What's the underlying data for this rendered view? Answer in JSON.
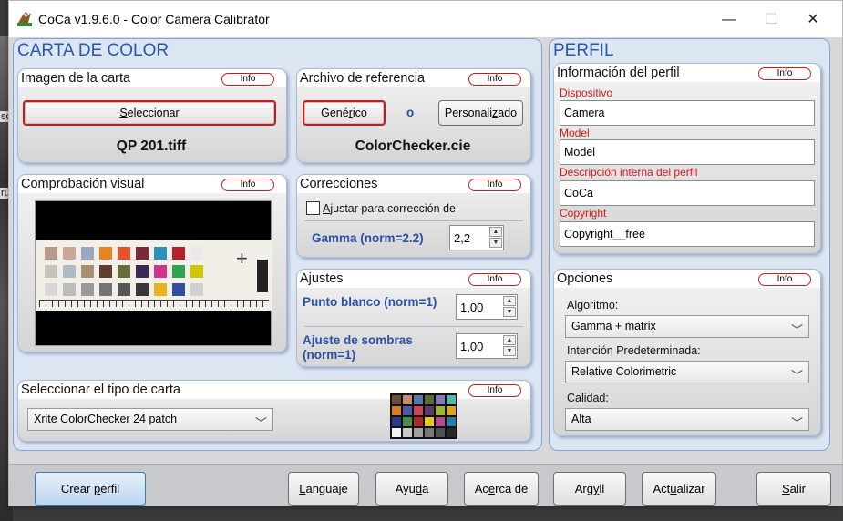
{
  "window": {
    "title": "CoCa v1.9.6.0 - Color Camera Calibrator",
    "minimize": "—",
    "maximize": "☐",
    "close": "✕"
  },
  "background_text": [
    "sc",
    "ru"
  ],
  "carta": {
    "title": "CARTA DE COLOR",
    "imagen": {
      "title": "Imagen de la carta",
      "info": "Info",
      "select_button": {
        "pre": "",
        "accel": "S",
        "post": "eleccionar"
      },
      "file": "QP 201.tiff"
    },
    "referencia": {
      "title": "Archivo de referencia",
      "info": "Info",
      "generic_button": {
        "pre": "Gené",
        "accel": "r",
        "post": "ico"
      },
      "or_text": "o",
      "custom_button": {
        "pre": "Personali",
        "accel": "z",
        "post": "ado"
      },
      "file": "ColorChecker.cie"
    },
    "comprobacion": {
      "title": "Comprobación visual",
      "info": "Info"
    },
    "correcciones": {
      "title": "Correcciones",
      "info": "Info",
      "checkbox_label": {
        "pre": "",
        "accel": "A",
        "post": "justar para corrección de"
      },
      "checkbox_checked": false,
      "gamma_label": "Gamma (norm=2.2)",
      "gamma_value": "2,2"
    },
    "ajustes": {
      "title": "Ajustes",
      "info": "Info",
      "punto_blanco_label": "Punto blanco (norm=1)",
      "punto_blanco_value": "1,00",
      "sombras_label_1": "Ajuste de sombras",
      "sombras_label_2": "(norm=1)",
      "sombras_value": "1,00"
    },
    "tipo": {
      "title": "Seleccionar el tipo de carta",
      "info": "Info",
      "selected": "Xrite ColorChecker 24 patch"
    }
  },
  "perfil": {
    "title": "PERFIL",
    "informacion": {
      "title": "Información del perfil",
      "info": "Info",
      "dispositivo_label": "Dispositivo",
      "dispositivo_value": "Camera",
      "model_label": "Model",
      "model_value": "Model",
      "descripcion_label": "Descripción interna del perfil",
      "descripcion_value": "CoCa",
      "copyright_label": "Copyright",
      "copyright_value": "Copyright__free"
    },
    "opciones": {
      "title": "Opciones",
      "info": "Info",
      "algoritmo_label": "Algoritmo:",
      "algoritmo_value": "Gamma + matrix",
      "intencion_label": "Intención Predeterminada:",
      "intencion_value": "Relative Colorimetric",
      "calidad_label": "Calidad:",
      "calidad_value": "Alta"
    }
  },
  "bottom": {
    "crear": {
      "pre": "Crear ",
      "accel": "p",
      "post": "erfil"
    },
    "lenguaje": {
      "pre": "",
      "accel": "L",
      "post": "anguaje"
    },
    "ayuda": {
      "pre": "Ayu",
      "accel": "d",
      "post": "a"
    },
    "acerca": {
      "pre": "Ac",
      "accel": "e",
      "post": "rca de"
    },
    "argyll": {
      "pre": "Arg",
      "accel": "y",
      "post": "ll"
    },
    "actualizar": {
      "pre": "Act",
      "accel": "u",
      "post": "alizar"
    },
    "salir": {
      "pre": "",
      "accel": "S",
      "post": "alir"
    }
  },
  "colors": {
    "accent_blue": "#2b57a8",
    "label_red": "#d81818",
    "info_border": "#c02020",
    "section_bg": "#dce6f3"
  }
}
